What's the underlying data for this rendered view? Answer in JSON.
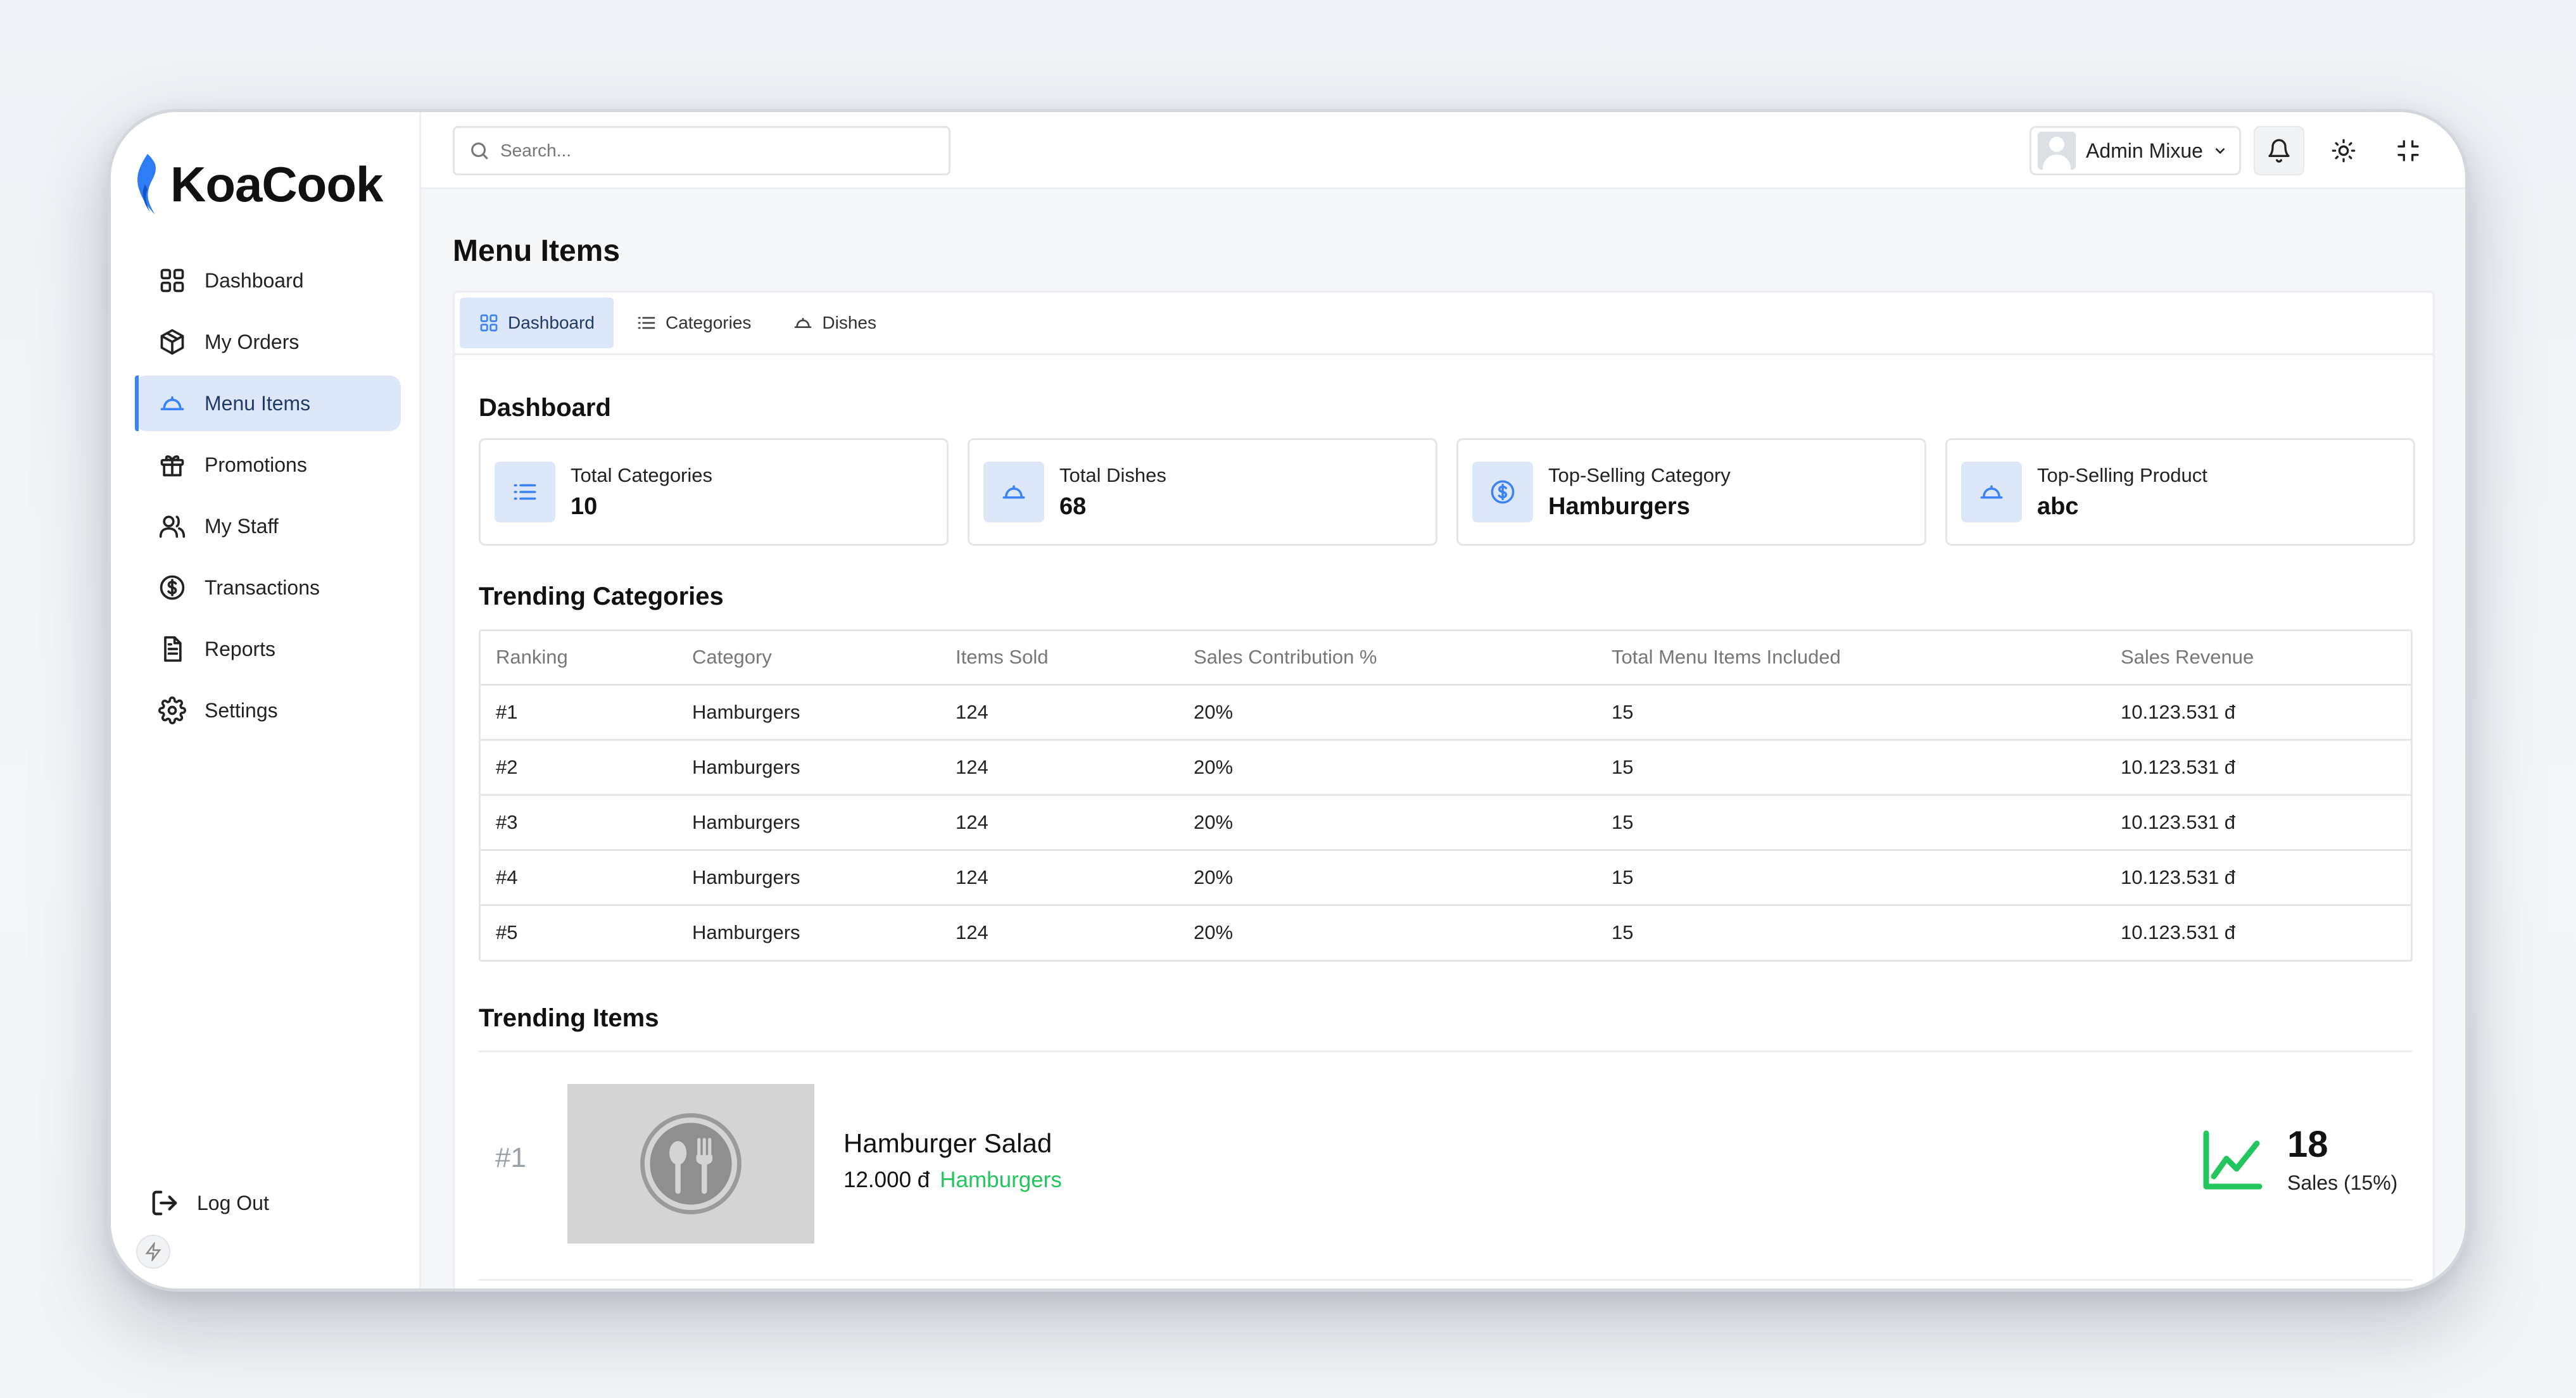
{
  "brand": {
    "name": "KoaCook"
  },
  "sidebar": {
    "items": [
      {
        "label": "Dashboard",
        "icon": "grid-icon"
      },
      {
        "label": "My Orders",
        "icon": "box-icon"
      },
      {
        "label": "Menu Items",
        "icon": "cloche-icon",
        "active": true
      },
      {
        "label": "Promotions",
        "icon": "gift-icon"
      },
      {
        "label": "My Staff",
        "icon": "users-icon"
      },
      {
        "label": "Transactions",
        "icon": "dollar-circle-icon"
      },
      {
        "label": "Reports",
        "icon": "document-icon"
      },
      {
        "label": "Settings",
        "icon": "gear-icon"
      }
    ],
    "logout": "Log Out"
  },
  "topbar": {
    "search_placeholder": "Search...",
    "user_name": "Admin Mixue"
  },
  "page": {
    "title": "Menu Items"
  },
  "tabs": [
    {
      "label": "Dashboard",
      "active": true
    },
    {
      "label": "Categories"
    },
    {
      "label": "Dishes"
    }
  ],
  "dashboard": {
    "title": "Dashboard",
    "stats": [
      {
        "label": "Total Categories",
        "value": "10",
        "icon": "list-icon"
      },
      {
        "label": "Total Dishes",
        "value": "68",
        "icon": "cloche-icon"
      },
      {
        "label": "Top-Selling Category",
        "value": "Hamburgers",
        "icon": "dollar-circle-icon"
      },
      {
        "label": "Top-Selling Product",
        "value": "abc",
        "icon": "cloche-icon"
      }
    ]
  },
  "trending_categories": {
    "title": "Trending Categories",
    "columns": [
      "Ranking",
      "Category",
      "Items Sold",
      "Sales Contribution %",
      "Total Menu Items Included",
      "Sales Revenue"
    ],
    "rows": [
      [
        "#1",
        "Hamburgers",
        "124",
        "20%",
        "15",
        "10.123.531 đ"
      ],
      [
        "#2",
        "Hamburgers",
        "124",
        "20%",
        "15",
        "10.123.531 đ"
      ],
      [
        "#3",
        "Hamburgers",
        "124",
        "20%",
        "15",
        "10.123.531 đ"
      ],
      [
        "#4",
        "Hamburgers",
        "124",
        "20%",
        "15",
        "10.123.531 đ"
      ],
      [
        "#5",
        "Hamburgers",
        "124",
        "20%",
        "15",
        "10.123.531 đ"
      ]
    ]
  },
  "trending_items": {
    "title": "Trending Items",
    "items": [
      {
        "rank": "#1",
        "name": "Hamburger Salad",
        "price": "12.000 đ",
        "category": "Hamburgers",
        "sales": "18",
        "sales_label": "Sales (15%)"
      }
    ]
  },
  "colors": {
    "accent": "#3b82f6",
    "accent_bg": "#dce8fa",
    "success": "#22c55e"
  }
}
